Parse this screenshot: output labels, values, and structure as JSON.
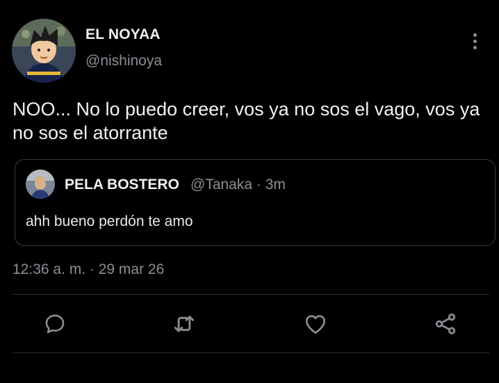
{
  "tweet": {
    "author_name": "EL NOYAA",
    "author_handle": "@nishinoya",
    "text": "NOO... No lo puedo creer, vos ya no sos el vago, vos ya no sos el atorrante",
    "timestamp": "12:36 a. m. · 29 mar 26"
  },
  "quoted_tweet": {
    "author_name": "PELA BOSTERO",
    "meta": "@Tanaka · 3m",
    "text": "ahh bueno perdón te amo"
  },
  "icons": {
    "more": "more-vertical-icon",
    "reply": "reply-icon",
    "retweet": "retweet-icon",
    "like": "heart-icon",
    "share": "share-icon"
  },
  "colors": {
    "background": "#000000",
    "primary_text": "#f2f2f2",
    "secondary_text": "#8b8f95",
    "border": "#3a3d42"
  }
}
